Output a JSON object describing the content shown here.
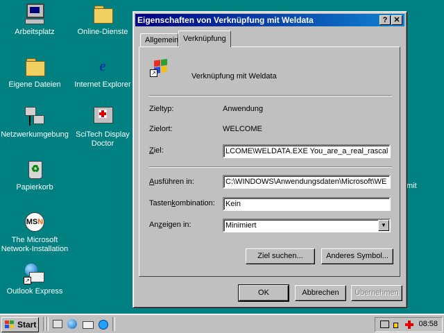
{
  "desktop": {
    "icons": [
      {
        "label": "Arbeitsplatz",
        "icon": "my-computer-icon"
      },
      {
        "label": "Online-Dienste",
        "icon": "folder-icon"
      },
      {
        "label": "Eigene Dateien",
        "icon": "my-documents-icon"
      },
      {
        "label": "Internet Explorer",
        "icon": "internet-explorer-icon"
      },
      {
        "label": "Netzwerkumgebung",
        "icon": "network-neighborhood-icon"
      },
      {
        "label": "SciTech Display Doctor",
        "icon": "scitech-display-doctor-icon"
      },
      {
        "label": "Papierkorb",
        "icon": "recycle-bin-icon"
      },
      {
        "label": "The Microsoft Network-Installation",
        "icon": "msn-icon"
      },
      {
        "label": "Outlook Express",
        "icon": "outlook-express-icon"
      }
    ],
    "stray_text": "mit"
  },
  "dialog": {
    "title": "Eigenschaften von Verknüpfung mit Weldata",
    "help_label": "?",
    "close_label": "✕",
    "tabs": [
      {
        "label": "Allgemein",
        "active": false
      },
      {
        "label": "Verknüpfung",
        "active": true
      }
    ],
    "header_name": "Verknüpfung mit Weldata",
    "fields": {
      "zieltyp_label": "Zieltyp:",
      "zieltyp_value": "Anwendung",
      "zielort_label": "Zielort:",
      "zielort_value": "WELCOME",
      "ziel_label_ul": "Z",
      "ziel_label_rest": "iel:",
      "ziel_value": "LCOME\\WELDATA.EXE You_are_a_real_rascal",
      "ausfuehren_label_ul": "A",
      "ausfuehren_label_rest": "usführen in:",
      "ausfuehren_value": "C:\\WINDOWS\\Anwendungsdaten\\Microsoft\\WE",
      "tasten_label_pre": "Tasten",
      "tasten_label_ul": "k",
      "tasten_label_post": "ombination:",
      "tasten_value": "Kein",
      "anzeigen_label_pre": "An",
      "anzeigen_label_ul": "z",
      "anzeigen_label_post": "eigen in:",
      "anzeigen_value": "Minimiert"
    },
    "buttons": {
      "find_target": "Ziel suchen...",
      "change_icon": "Anderes Symbol...",
      "ok": "OK",
      "cancel": "Abbrechen",
      "apply": "Übernehmen"
    }
  },
  "taskbar": {
    "start_label": "Start",
    "clock": "08:58",
    "quick_launch": [
      "show-desktop-icon",
      "internet-explorer-icon",
      "outlook-express-icon",
      "channels-icon"
    ],
    "tray": [
      "display-settings-icon",
      "volume-icon",
      "scitech-tray-icon"
    ]
  },
  "colors": {
    "desktop": "#008080",
    "titlebar_start": "#000080",
    "titlebar_end": "#1084d0",
    "face": "#c0c0c0"
  }
}
